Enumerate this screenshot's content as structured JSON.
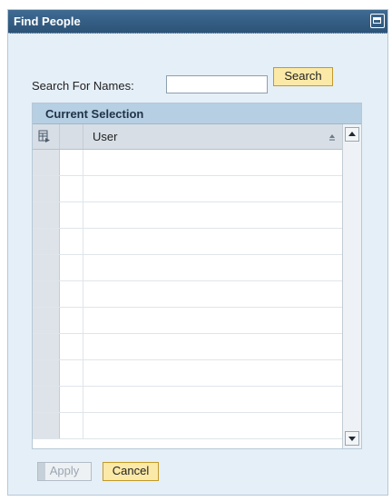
{
  "dialog": {
    "title": "Find People",
    "maximize_icon": "maximize-icon"
  },
  "search": {
    "label": "Search For Names:",
    "value": "",
    "placeholder": "",
    "button_label": "Search"
  },
  "selection_panel": {
    "title": "Current Selection",
    "columns": {
      "settings_icon": "table-settings-icon",
      "user_label": "User",
      "sort_icon": "sort-ascending-icon"
    },
    "rows": [
      "",
      "",
      "",
      "",
      "",
      "",
      "",
      "",
      "",
      "",
      "",
      ""
    ],
    "scroll_up_icon": "scroll-up-icon",
    "scroll_down_icon": "scroll-down-icon"
  },
  "footer": {
    "apply_label": "Apply",
    "cancel_label": "Cancel"
  },
  "colors": {
    "title_bg": "#2c5377",
    "dialog_bg": "#e5eff7",
    "panel_header_bg": "#b7cfe2",
    "button_bg": "#fbe9a7",
    "button_border": "#c39a29"
  }
}
